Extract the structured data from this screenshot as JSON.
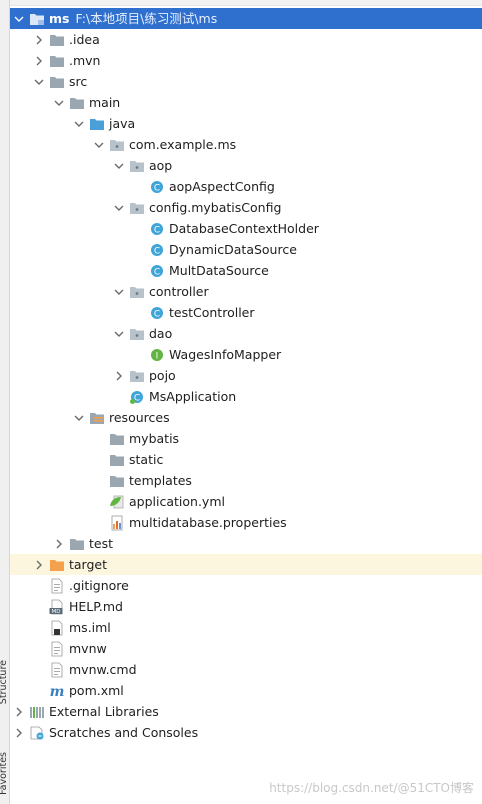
{
  "sidebar": {
    "tabs": [
      "Structure",
      "Favorites"
    ]
  },
  "tree": {
    "root": {
      "name": "ms",
      "path": "F:\\本地项目\\练习测试\\ms"
    },
    "items": [
      {
        "label": "ms",
        "icon": "module-folder-icon"
      },
      {
        "label": ".idea",
        "icon": "folder-icon"
      },
      {
        "label": ".mvn",
        "icon": "folder-icon"
      },
      {
        "label": "src",
        "icon": "folder-icon"
      },
      {
        "label": "main",
        "icon": "folder-icon"
      },
      {
        "label": "java",
        "icon": "source-folder-icon"
      },
      {
        "label": "com.example.ms",
        "icon": "package-icon"
      },
      {
        "label": "aop",
        "icon": "package-icon"
      },
      {
        "label": "aopAspectConfig",
        "icon": "class-icon"
      },
      {
        "label": "config.mybatisConfig",
        "icon": "package-icon"
      },
      {
        "label": "DatabaseContextHolder",
        "icon": "class-icon"
      },
      {
        "label": "DynamicDataSource",
        "icon": "class-icon"
      },
      {
        "label": "MultDataSource",
        "icon": "class-icon"
      },
      {
        "label": "controller",
        "icon": "package-icon"
      },
      {
        "label": "testController",
        "icon": "class-icon"
      },
      {
        "label": "dao",
        "icon": "package-icon"
      },
      {
        "label": "WagesInfoMapper",
        "icon": "interface-icon"
      },
      {
        "label": "pojo",
        "icon": "package-icon"
      },
      {
        "label": "MsApplication",
        "icon": "spring-boot-class-icon"
      },
      {
        "label": "resources",
        "icon": "resources-folder-icon"
      },
      {
        "label": "mybatis",
        "icon": "folder-icon"
      },
      {
        "label": "static",
        "icon": "folder-icon"
      },
      {
        "label": "templates",
        "icon": "folder-icon"
      },
      {
        "label": "application.yml",
        "icon": "spring-yml-icon"
      },
      {
        "label": "multidatabase.properties",
        "icon": "properties-file-icon"
      },
      {
        "label": "test",
        "icon": "folder-icon"
      },
      {
        "label": "target",
        "icon": "excluded-folder-icon"
      },
      {
        "label": ".gitignore",
        "icon": "text-file-icon"
      },
      {
        "label": "HELP.md",
        "icon": "markdown-file-icon"
      },
      {
        "label": "ms.iml",
        "icon": "iml-file-icon"
      },
      {
        "label": "mvnw",
        "icon": "text-file-icon"
      },
      {
        "label": "mvnw.cmd",
        "icon": "text-file-icon"
      },
      {
        "label": "pom.xml",
        "icon": "maven-icon"
      },
      {
        "label": "External Libraries",
        "icon": "libraries-icon"
      },
      {
        "label": "Scratches and Consoles",
        "icon": "scratches-icon"
      }
    ]
  },
  "watermark": "https://blog.csdn.net/@51CTO博客",
  "colors": {
    "selection": "#2f6fce",
    "excluded_bg": "#fcf6df",
    "folder": "#9aa7b0",
    "source_folder": "#4a9fd8",
    "class_icon": "#3fa4d8",
    "interface_icon": "#62b543",
    "excluded_folder": "#f3a14d"
  }
}
